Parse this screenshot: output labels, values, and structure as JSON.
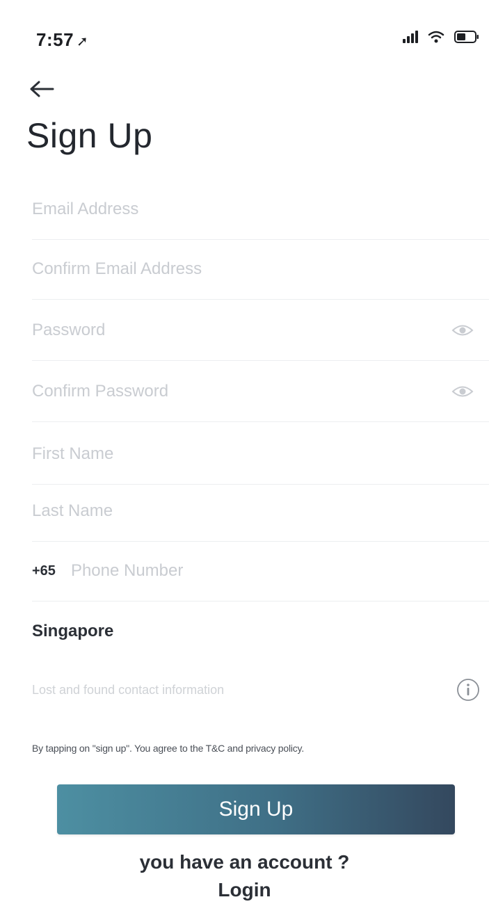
{
  "status_bar": {
    "time": "7:57",
    "location_glyph": "➚"
  },
  "header": {
    "back_icon": "arrow-left-icon",
    "title": "Sign Up"
  },
  "form": {
    "email_placeholder": "Email Address",
    "confirm_email_placeholder": "Confirm Email Address",
    "password_placeholder": "Password",
    "confirm_password_placeholder": "Confirm Password",
    "first_name_placeholder": "First Name",
    "last_name_placeholder": "Last Name",
    "phone_prefix": "+65",
    "phone_placeholder": "Phone Number",
    "country": "Singapore",
    "lost_found_placeholder": "Lost and found contact information"
  },
  "terms": "By tapping on \"sign up\". You agree to the T&C and privacy policy.",
  "signup_button_label": "Sign Up",
  "account_prompt": "you have an account ?",
  "login_label": "Login",
  "colors": {
    "button_start": "#4d8fa2",
    "button_end": "#34485e",
    "placeholder": "#c9ccd1",
    "text": "#2b2f36"
  }
}
